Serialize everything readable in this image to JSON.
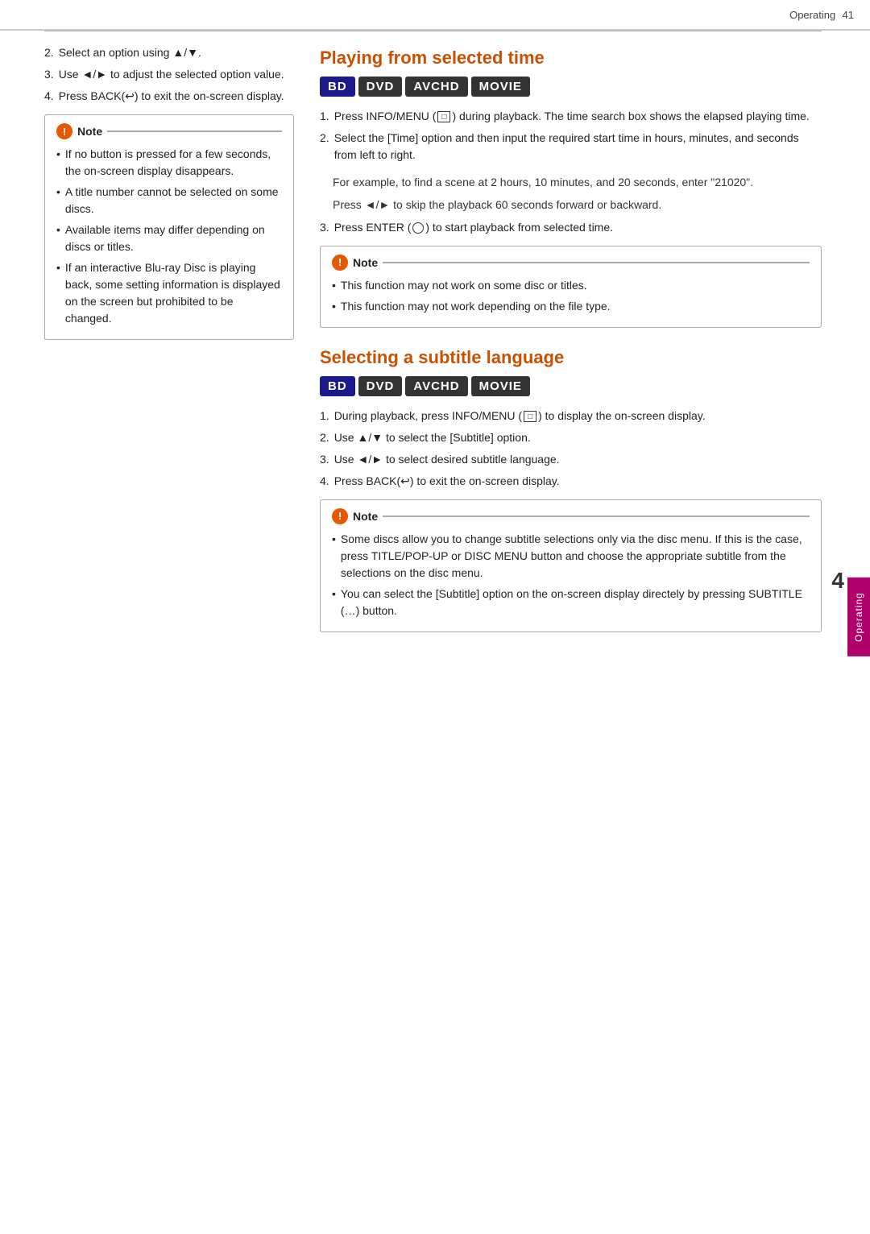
{
  "header": {
    "text": "Operating",
    "page": "41"
  },
  "side_tab": {
    "label": "Operating",
    "number": "4"
  },
  "left_column": {
    "intro_items": [
      {
        "num": "2.",
        "text": "Select an option using ▲/▼."
      },
      {
        "num": "3.",
        "text": "Use ◄/► to adjust the selected option value."
      },
      {
        "num": "4.",
        "text": "Press BACK(↩) to exit the on-screen display."
      }
    ],
    "note": {
      "label": "Note",
      "bullets": [
        "If no button is pressed for a few seconds, the on-screen display disappears.",
        "A title number cannot be selected on some discs.",
        "Available items may differ depending on discs or titles.",
        "If an interactive Blu-ray Disc is playing back, some setting information is displayed on the screen but prohibited to be changed."
      ]
    }
  },
  "right_column": {
    "section1": {
      "title": "Playing from selected time",
      "badges": [
        "BD",
        "DVD",
        "AVCHD",
        "MOVIE"
      ],
      "steps": [
        {
          "num": "1.",
          "text": "Press INFO/MENU (□) during playback. The time search box shows the elapsed playing time."
        },
        {
          "num": "2.",
          "text": "Select the [Time] option and then input the required start time in hours, minutes, and seconds from left to right."
        }
      ],
      "indent_paras": [
        "For example, to find a scene at 2 hours, 10 minutes, and 20 seconds, enter \"21020\".",
        "Press ◄/► to skip the playback 60 seconds forward or backward."
      ],
      "step3": {
        "num": "3.",
        "text": "Press ENTER (⊙) to start playback from selected time."
      },
      "note": {
        "label": "Note",
        "bullets": [
          "This function may not work on some disc or titles.",
          "This function may not work depending on the file type."
        ]
      }
    },
    "section2": {
      "title": "Selecting a subtitle language",
      "badges": [
        "BD",
        "DVD",
        "AVCHD",
        "MOVIE"
      ],
      "steps": [
        {
          "num": "1.",
          "text": "During playback, press INFO/MENU (□) to display the on-screen display."
        },
        {
          "num": "2.",
          "text": "Use ▲/▼ to select the [Subtitle] option."
        },
        {
          "num": "3.",
          "text": "Use ◄/► to select desired subtitle language."
        },
        {
          "num": "4.",
          "text": "Press BACK(↩) to exit the on-screen display."
        }
      ],
      "note": {
        "label": "Note",
        "bullets": [
          "Some discs allow you to change subtitle selections only via the disc menu. If this is the case, press TITLE/POP-UP or DISC MENU button and choose the appropriate subtitle from the selections on the disc menu.",
          "You can select the [Subtitle] option on the on-screen display directely by pressing SUBTITLE (…) button."
        ]
      }
    }
  }
}
